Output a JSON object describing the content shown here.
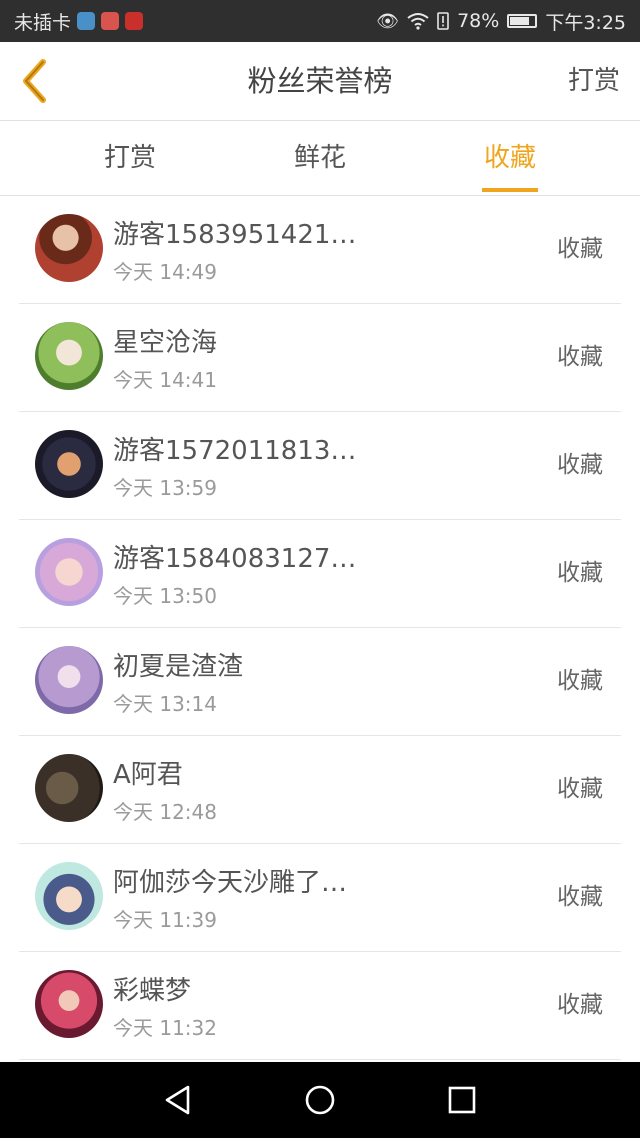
{
  "status_bar": {
    "carrier": "未插卡",
    "battery": "78%",
    "battery_level": 0.78,
    "time": "下午3:25"
  },
  "header": {
    "title": "粉丝荣誉榜",
    "action_label": "打赏",
    "back_icon": "chevron-left-icon"
  },
  "tabs": [
    {
      "label": "打赏",
      "active": false
    },
    {
      "label": "鲜花",
      "active": false
    },
    {
      "label": "收藏",
      "active": true
    }
  ],
  "accent_color": "#efa51e",
  "items": [
    {
      "name": "游客1583951421…",
      "time": "今天 14:49",
      "action": "收藏"
    },
    {
      "name": "星空沧海",
      "time": "今天 14:41",
      "action": "收藏"
    },
    {
      "name": "游客1572011813…",
      "time": "今天 13:59",
      "action": "收藏"
    },
    {
      "name": "游客1584083127…",
      "time": "今天 13:50",
      "action": "收藏"
    },
    {
      "name": "初夏是渣渣",
      "time": "今天 13:14",
      "action": "收藏"
    },
    {
      "name": "A阿君",
      "time": "今天 12:48",
      "action": "收藏"
    },
    {
      "name": "阿伽莎今天沙雕了…",
      "time": "今天 11:39",
      "action": "收藏"
    },
    {
      "name": "彩蝶梦",
      "time": "今天 11:32",
      "action": "收藏"
    }
  ],
  "nav_bar": {
    "icons": [
      "back-triangle-icon",
      "home-circle-icon",
      "recents-square-icon"
    ]
  }
}
